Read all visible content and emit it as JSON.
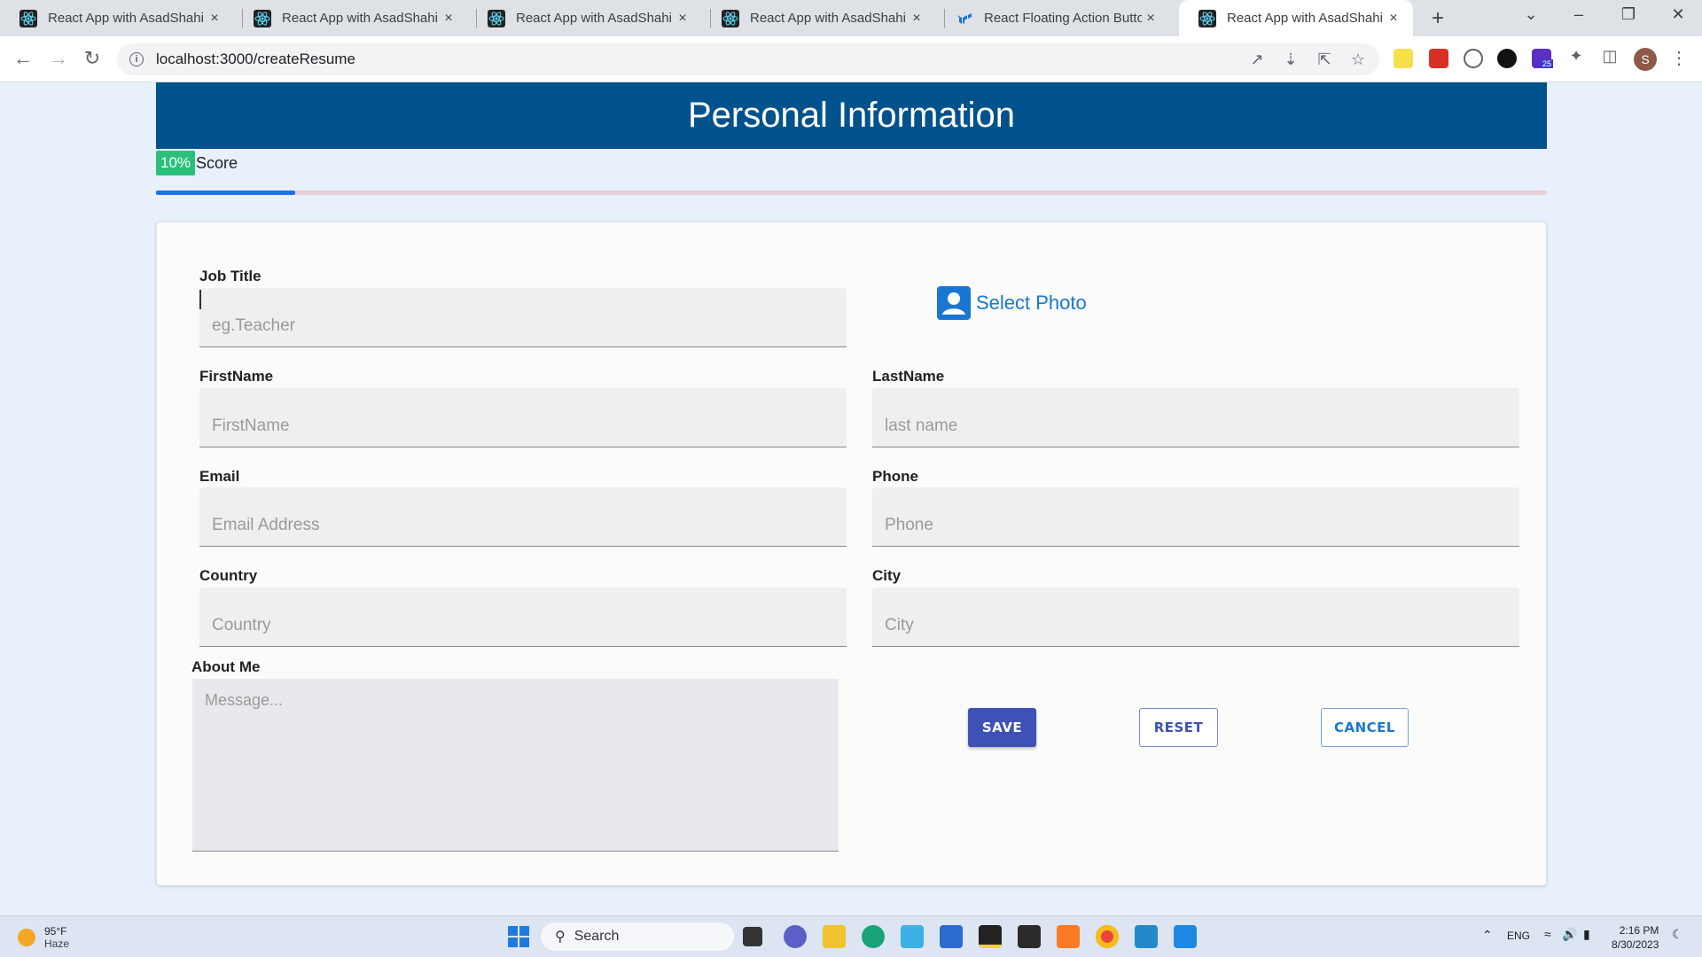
{
  "browser": {
    "tabs": [
      {
        "title": "React App with AsadShahi",
        "active": false
      },
      {
        "title": "React App with AsadShahi",
        "active": false
      },
      {
        "title": "React App with AsadShahi",
        "active": false
      },
      {
        "title": "React App with AsadShahi",
        "active": false
      },
      {
        "title": "React Floating Action Button",
        "active": false
      },
      {
        "title": "React App with AsadShahi",
        "active": true
      }
    ],
    "close_glyph": "×",
    "new_tab_glyph": "+",
    "url": "localhost:3000/createResume",
    "profile_initial": "S",
    "extension_badge": "25"
  },
  "page": {
    "title": "Personal Information",
    "score": {
      "badge": "10%",
      "label": "Score",
      "progress_fraction": 0.1
    },
    "form": {
      "job_title": {
        "label": "Job Title",
        "placeholder": "eg.Teacher"
      },
      "select_photo": {
        "label": "Select Photo"
      },
      "first_name": {
        "label": "FirstName",
        "placeholder": "FirstName"
      },
      "last_name": {
        "label": "LastName",
        "placeholder": "last name"
      },
      "email": {
        "label": "Email",
        "placeholder": "Email Address"
      },
      "phone": {
        "label": "Phone",
        "placeholder": "Phone"
      },
      "country": {
        "label": "Country",
        "placeholder": "Country"
      },
      "city": {
        "label": "City",
        "placeholder": "City"
      },
      "about": {
        "label": "About Me",
        "placeholder": "Message..."
      }
    },
    "buttons": {
      "save": "SAVE",
      "reset": "RESET",
      "cancel": "CANCEL"
    }
  },
  "taskbar": {
    "weather": {
      "temp": "95°F",
      "condition": "Haze"
    },
    "search_label": "Search",
    "language": "ENG",
    "time": "2:16 PM",
    "date": "8/30/2023"
  },
  "colors": {
    "header_bg": "#00528c",
    "score_badge": "#2bbf7a",
    "progress_fill": "#1a73e8",
    "primary_button": "#3f51b5",
    "link_blue": "#1976d2"
  }
}
